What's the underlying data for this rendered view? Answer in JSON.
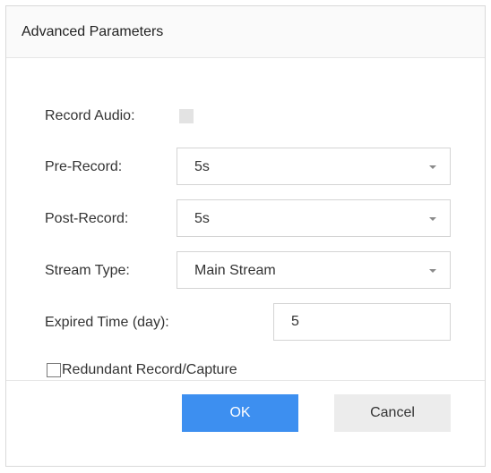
{
  "dialog": {
    "title": "Advanced Parameters"
  },
  "fields": {
    "record_audio": {
      "label": "Record Audio:",
      "checked": false
    },
    "pre_record": {
      "label": "Pre-Record:",
      "value": "5s"
    },
    "post_record": {
      "label": "Post-Record:",
      "value": "5s"
    },
    "stream_type": {
      "label": "Stream Type:",
      "value": "Main Stream"
    },
    "expired_time": {
      "label": "Expired Time (day):",
      "value": "5"
    },
    "redundant": {
      "label": "Redundant Record/Capture",
      "checked": false
    }
  },
  "buttons": {
    "ok_label": "OK",
    "cancel_label": "Cancel"
  },
  "colors": {
    "primary_button": "#3d8ff0",
    "secondary_button": "#ececec",
    "border": "#d4d4d4"
  }
}
